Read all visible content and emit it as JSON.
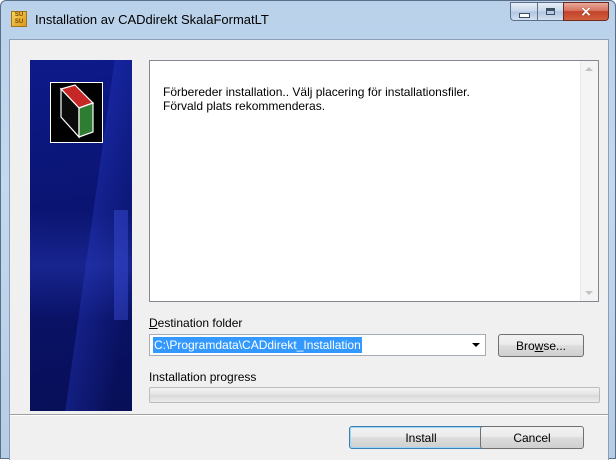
{
  "window": {
    "title": "Installation av CADdirekt SkalaFormatLT",
    "icon": "app-installer-icon",
    "controls": {
      "minimize": "minimize-icon",
      "maximize": "maximize-icon",
      "close": "×"
    }
  },
  "info": {
    "text": "Förbereder installation.. Välj placering för installationsfiler.\nFörvald plats rekommenderas."
  },
  "destination": {
    "label": "Destination folder",
    "path": "C:\\Programdata\\CADdirekt_Installation",
    "browse_label": "Browse..."
  },
  "progress": {
    "label": "Installation progress",
    "value": 0
  },
  "footer": {
    "install_label": "Install",
    "cancel_label": "Cancel"
  },
  "colors": {
    "banner": "#0a1470",
    "selection": "#3399ff",
    "progress": "#06b025"
  }
}
